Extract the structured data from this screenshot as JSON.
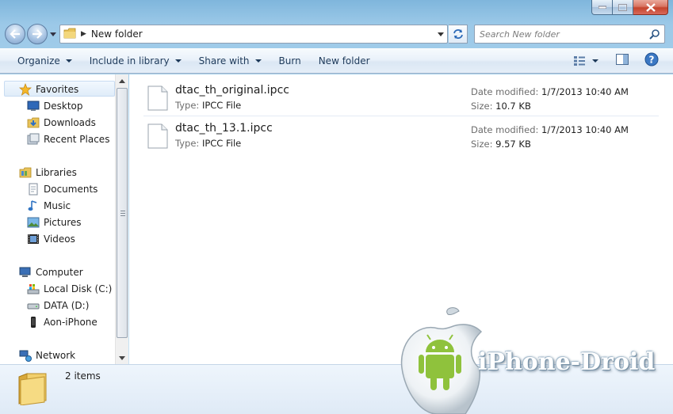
{
  "window": {
    "controls": [
      "minimize",
      "maximize",
      "close"
    ]
  },
  "address_bar": {
    "path": [
      "New folder"
    ],
    "icon": "folder-icon"
  },
  "search": {
    "placeholder": "Search New folder"
  },
  "toolbar": {
    "organize": "Organize",
    "include_in_library": "Include in library",
    "share_with": "Share with",
    "burn": "Burn",
    "new_folder": "New folder",
    "right_icons": [
      "view-options-icon",
      "preview-pane-icon",
      "help-icon"
    ]
  },
  "nav_pane": {
    "favorites": {
      "label": "Favorites",
      "items": [
        {
          "label": "Desktop",
          "icon": "desktop-icon"
        },
        {
          "label": "Downloads",
          "icon": "downloads-icon"
        },
        {
          "label": "Recent Places",
          "icon": "recent-places-icon"
        }
      ]
    },
    "libraries": {
      "label": "Libraries",
      "items": [
        {
          "label": "Documents",
          "icon": "documents-icon"
        },
        {
          "label": "Music",
          "icon": "music-icon"
        },
        {
          "label": "Pictures",
          "icon": "pictures-icon"
        },
        {
          "label": "Videos",
          "icon": "videos-icon"
        }
      ]
    },
    "computer": {
      "label": "Computer",
      "items": [
        {
          "label": "Local Disk (C:)",
          "icon": "local-disk-icon"
        },
        {
          "label": "DATA (D:)",
          "icon": "drive-icon"
        },
        {
          "label": "Aon-iPhone",
          "icon": "iphone-icon"
        }
      ]
    },
    "network": {
      "label": "Network"
    }
  },
  "files": [
    {
      "name": "dtac_th_original.ipcc",
      "type_label": "Type:",
      "type": "IPCC File",
      "date_label": "Date modified:",
      "date": "1/7/2013 10:40 AM",
      "size_label": "Size:",
      "size": "10.7 KB"
    },
    {
      "name": "dtac_th_13.1.ipcc",
      "type_label": "Type:",
      "type": "IPCC File",
      "date_label": "Date modified:",
      "date": "1/7/2013 10:40 AM",
      "size_label": "Size:",
      "size": "9.57 KB"
    }
  ],
  "details_pane": {
    "count": "2 items"
  },
  "watermark": {
    "text": "iPhone-Droid"
  }
}
